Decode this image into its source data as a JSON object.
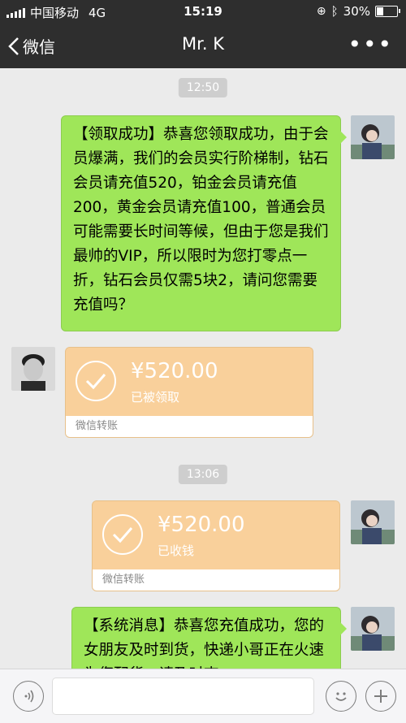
{
  "status_bar": {
    "carrier": "中国移动",
    "network": "4G",
    "time": "15:19",
    "battery": "30%",
    "battery_level": 0.3
  },
  "nav": {
    "back_label": "微信",
    "title": "Mr. K",
    "more_label": "•••"
  },
  "chat": {
    "messages": [
      {
        "type": "timestamp",
        "text": "12:50"
      },
      {
        "type": "text",
        "side": "right",
        "text": "【领取成功】恭喜您领取成功，由于会员爆满，我们的会员实行阶梯制，钻石会员请充值520，铂金会员请充值200，黄金会员请充值100，普通会员可能需要长时间等候，但由于您是我们最帅的VIP，所以限时为您打零点一折，钻石会员仅需5块2，请问您需要充值吗？"
      },
      {
        "type": "transfer",
        "side": "left",
        "amount": "¥520.00",
        "status": "已被领取",
        "footer": "微信转账"
      },
      {
        "type": "timestamp",
        "text": "13:06"
      },
      {
        "type": "transfer",
        "side": "right",
        "amount": "¥520.00",
        "status": "已收钱",
        "footer": "微信转账"
      },
      {
        "type": "text",
        "side": "right",
        "text": "【系统消息】恭喜您充值成功，您的女朋友及时到货，快递小哥正在火速为您配货，请及时查"
      }
    ]
  },
  "colors": {
    "bar_bg": "#2e2e2e",
    "chat_bg": "#ebebeb",
    "bubble_green": "#9fe659",
    "transfer_orange": "#f9d09b"
  }
}
